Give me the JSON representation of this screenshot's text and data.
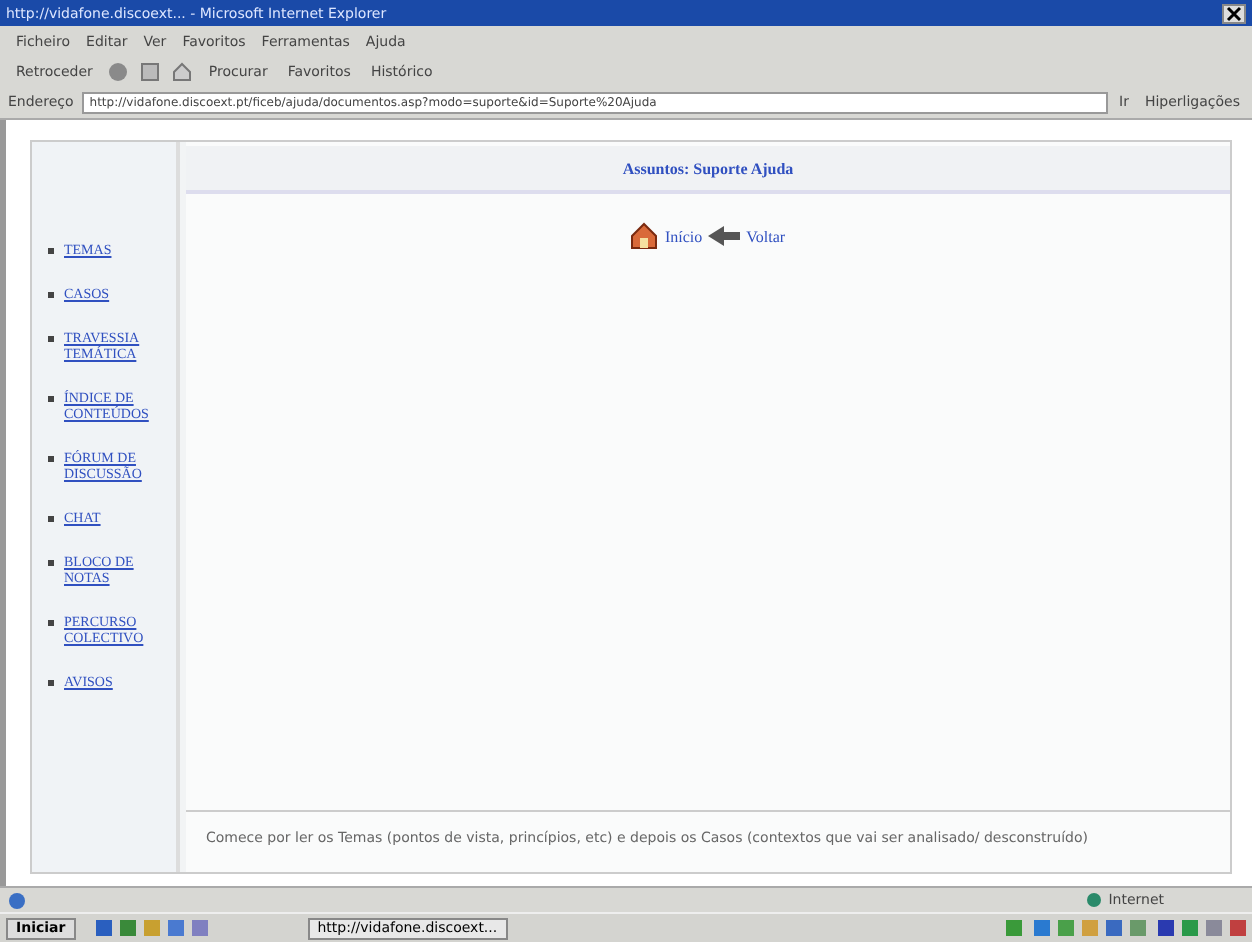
{
  "window": {
    "title": "http://vidafone.discoext... - Microsoft Internet Explorer"
  },
  "menu": [
    "Ficheiro",
    "Editar",
    "Ver",
    "Favoritos",
    "Ferramentas",
    "Ajuda"
  ],
  "toolbar": {
    "back": "Retroceder",
    "search": "Procurar",
    "favorites": "Favoritos",
    "history": "Histórico"
  },
  "address": {
    "label": "Endereço",
    "value": "http://vidafone.discoext.pt/ficeb/ajuda/documentos.asp?modo=suporte&id=Suporte%20Ajuda",
    "go": "Ir",
    "links": "Hiperligações"
  },
  "sidebar": {
    "items": [
      "TEMAS",
      "CASOS",
      "TRAVESSIA TEMÁTICA",
      "ÍNDICE DE CONTEÚDOS",
      "FÓRUM DE DISCUSSÃO",
      "CHAT",
      "BLOCO DE NOTAS",
      "PERCURSO COLECTIVO",
      "AVISOS"
    ]
  },
  "main": {
    "heading": "Assuntos: Suporte Ajuda",
    "links": [
      {
        "kind": "home",
        "label": "Início"
      },
      {
        "kind": "back",
        "label": "Voltar"
      }
    ],
    "footer": "Comece por ler os Temas (pontos de vista, princípios, etc) e depois os Casos (contextos que vai ser analisado/ desconstruído)"
  },
  "status_bar": {
    "zone": "Internet"
  },
  "taskbar": {
    "start": "Iniciar",
    "tasks": [
      "http://vidafone.discoext..."
    ]
  }
}
